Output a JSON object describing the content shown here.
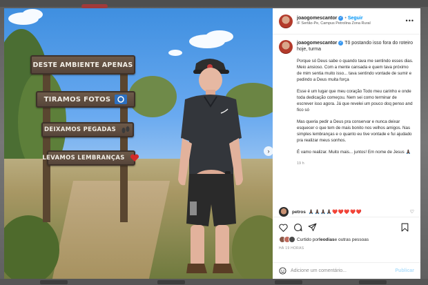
{
  "post": {
    "username": "joaogomescantor",
    "follow_label": "Seguir",
    "location": "IF Sertão-Pe, Campus Petrolina Zona Rural",
    "caption_title": "Tô postando isso fora do roteiro hoje, turma",
    "caption_paragraphs": [
      "Porque só Deus sabe o quando tava me sentindo esses dias. Meio ansioso. Com a mente cansada e quem tava próximo de mim sentia muito isso... tava sentindo vontade de sumir e pedindo a Deus muita força",
      "Esse é um lugar que meu coração Todo meu carinho e onde toda dedicação começou. Nem sei como terminar de escrever isso agora. Já que revelei um pouco doq penso and fico só",
      "Mas queria pedir a Deus pra conservar e nunca deixar esquecer o que tem de mais bonito nos velhos amigos. Nas simples lembranças e o quanto eu tive vontade e fui ajudado pra realizar meus sonhos.",
      "É vamo realizar. Muito mais... juntos! Em nome de Jesus 🙏🏿"
    ],
    "caption_age": "19 h",
    "comment": {
      "user": "petros",
      "text": "🙏🏿🙏🏿🙏🏿🙏🏿❤️❤️❤️❤️❤️"
    },
    "likes_text_prefix": "Curtido por ",
    "likes_user": "leodias",
    "likes_text_suffix": " e outras pessoas",
    "date": "HÁ 19 HORAS",
    "add_comment_placeholder": "Adicione um comentário...",
    "publish_label": "Publicar"
  },
  "photo": {
    "signs": [
      "DESTE AMBIENTE APENAS",
      "TIRAMOS FOTOS",
      "DEIXAMOS PEGADAS",
      "LEVAMOS LEMBRANÇAS"
    ],
    "colors": {
      "sky": "#4f9ae6",
      "sign_wood": "#5f4d3f",
      "shirt": "#33363b",
      "shorts": "#2a2a2a"
    }
  },
  "icons": [
    "verified-icon",
    "more-icon",
    "like-icon",
    "comment-icon",
    "share-icon",
    "save-icon",
    "emoji-icon",
    "camera-icon",
    "footprint-icon",
    "heart-icon",
    "next-icon"
  ],
  "colors": {
    "link_blue": "#0095f6",
    "verified_blue": "#3897f0",
    "text": "#262626",
    "muted": "#8e8e8e"
  }
}
